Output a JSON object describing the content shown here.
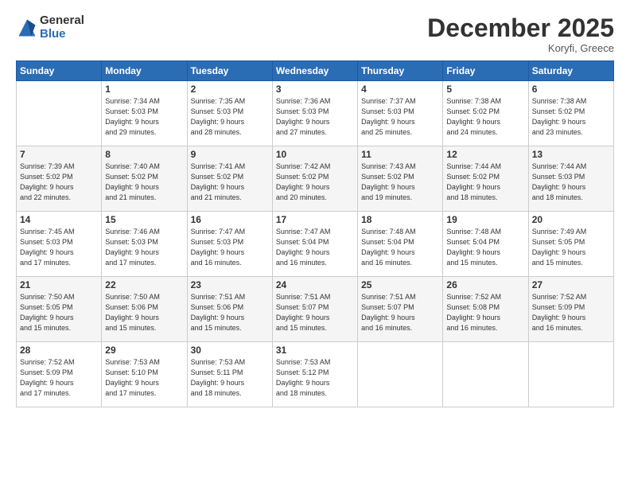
{
  "logo": {
    "general": "General",
    "blue": "Blue"
  },
  "title": "December 2025",
  "location": "Koryfi, Greece",
  "days_header": [
    "Sunday",
    "Monday",
    "Tuesday",
    "Wednesday",
    "Thursday",
    "Friday",
    "Saturday"
  ],
  "weeks": [
    [
      {
        "day": "",
        "info": ""
      },
      {
        "day": "1",
        "info": "Sunrise: 7:34 AM\nSunset: 5:03 PM\nDaylight: 9 hours\nand 29 minutes."
      },
      {
        "day": "2",
        "info": "Sunrise: 7:35 AM\nSunset: 5:03 PM\nDaylight: 9 hours\nand 28 minutes."
      },
      {
        "day": "3",
        "info": "Sunrise: 7:36 AM\nSunset: 5:03 PM\nDaylight: 9 hours\nand 27 minutes."
      },
      {
        "day": "4",
        "info": "Sunrise: 7:37 AM\nSunset: 5:03 PM\nDaylight: 9 hours\nand 25 minutes."
      },
      {
        "day": "5",
        "info": "Sunrise: 7:38 AM\nSunset: 5:02 PM\nDaylight: 9 hours\nand 24 minutes."
      },
      {
        "day": "6",
        "info": "Sunrise: 7:38 AM\nSunset: 5:02 PM\nDaylight: 9 hours\nand 23 minutes."
      }
    ],
    [
      {
        "day": "7",
        "info": "Sunrise: 7:39 AM\nSunset: 5:02 PM\nDaylight: 9 hours\nand 22 minutes."
      },
      {
        "day": "8",
        "info": "Sunrise: 7:40 AM\nSunset: 5:02 PM\nDaylight: 9 hours\nand 21 minutes."
      },
      {
        "day": "9",
        "info": "Sunrise: 7:41 AM\nSunset: 5:02 PM\nDaylight: 9 hours\nand 21 minutes."
      },
      {
        "day": "10",
        "info": "Sunrise: 7:42 AM\nSunset: 5:02 PM\nDaylight: 9 hours\nand 20 minutes."
      },
      {
        "day": "11",
        "info": "Sunrise: 7:43 AM\nSunset: 5:02 PM\nDaylight: 9 hours\nand 19 minutes."
      },
      {
        "day": "12",
        "info": "Sunrise: 7:44 AM\nSunset: 5:02 PM\nDaylight: 9 hours\nand 18 minutes."
      },
      {
        "day": "13",
        "info": "Sunrise: 7:44 AM\nSunset: 5:03 PM\nDaylight: 9 hours\nand 18 minutes."
      }
    ],
    [
      {
        "day": "14",
        "info": "Sunrise: 7:45 AM\nSunset: 5:03 PM\nDaylight: 9 hours\nand 17 minutes."
      },
      {
        "day": "15",
        "info": "Sunrise: 7:46 AM\nSunset: 5:03 PM\nDaylight: 9 hours\nand 17 minutes."
      },
      {
        "day": "16",
        "info": "Sunrise: 7:47 AM\nSunset: 5:03 PM\nDaylight: 9 hours\nand 16 minutes."
      },
      {
        "day": "17",
        "info": "Sunrise: 7:47 AM\nSunset: 5:04 PM\nDaylight: 9 hours\nand 16 minutes."
      },
      {
        "day": "18",
        "info": "Sunrise: 7:48 AM\nSunset: 5:04 PM\nDaylight: 9 hours\nand 16 minutes."
      },
      {
        "day": "19",
        "info": "Sunrise: 7:48 AM\nSunset: 5:04 PM\nDaylight: 9 hours\nand 15 minutes."
      },
      {
        "day": "20",
        "info": "Sunrise: 7:49 AM\nSunset: 5:05 PM\nDaylight: 9 hours\nand 15 minutes."
      }
    ],
    [
      {
        "day": "21",
        "info": "Sunrise: 7:50 AM\nSunset: 5:05 PM\nDaylight: 9 hours\nand 15 minutes."
      },
      {
        "day": "22",
        "info": "Sunrise: 7:50 AM\nSunset: 5:06 PM\nDaylight: 9 hours\nand 15 minutes."
      },
      {
        "day": "23",
        "info": "Sunrise: 7:51 AM\nSunset: 5:06 PM\nDaylight: 9 hours\nand 15 minutes."
      },
      {
        "day": "24",
        "info": "Sunrise: 7:51 AM\nSunset: 5:07 PM\nDaylight: 9 hours\nand 15 minutes."
      },
      {
        "day": "25",
        "info": "Sunrise: 7:51 AM\nSunset: 5:07 PM\nDaylight: 9 hours\nand 16 minutes."
      },
      {
        "day": "26",
        "info": "Sunrise: 7:52 AM\nSunset: 5:08 PM\nDaylight: 9 hours\nand 16 minutes."
      },
      {
        "day": "27",
        "info": "Sunrise: 7:52 AM\nSunset: 5:09 PM\nDaylight: 9 hours\nand 16 minutes."
      }
    ],
    [
      {
        "day": "28",
        "info": "Sunrise: 7:52 AM\nSunset: 5:09 PM\nDaylight: 9 hours\nand 17 minutes."
      },
      {
        "day": "29",
        "info": "Sunrise: 7:53 AM\nSunset: 5:10 PM\nDaylight: 9 hours\nand 17 minutes."
      },
      {
        "day": "30",
        "info": "Sunrise: 7:53 AM\nSunset: 5:11 PM\nDaylight: 9 hours\nand 18 minutes."
      },
      {
        "day": "31",
        "info": "Sunrise: 7:53 AM\nSunset: 5:12 PM\nDaylight: 9 hours\nand 18 minutes."
      },
      {
        "day": "",
        "info": ""
      },
      {
        "day": "",
        "info": ""
      },
      {
        "day": "",
        "info": ""
      }
    ]
  ]
}
